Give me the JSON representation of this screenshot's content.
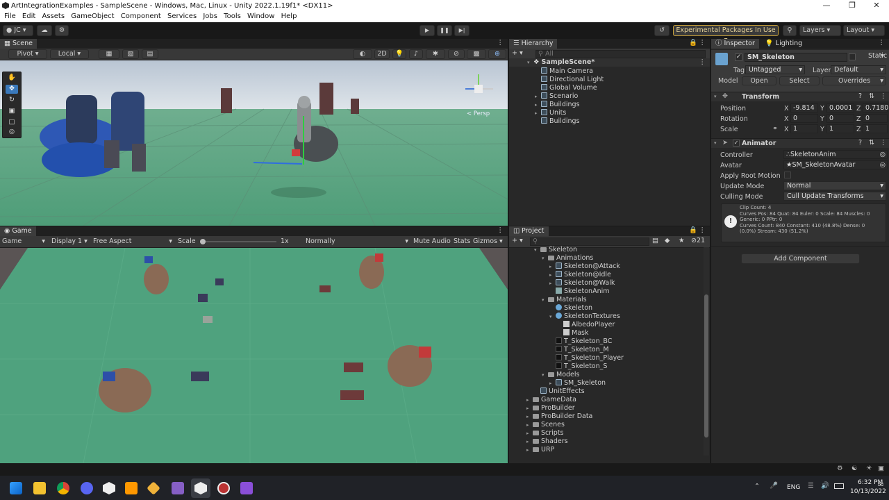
{
  "window": {
    "title": "ArtIntegrationExamples - SampleScene - Windows, Mac, Linux - Unity 2022.1.19f1* <DX11>"
  },
  "menu": [
    "File",
    "Edit",
    "Assets",
    "GameObject",
    "Component",
    "Services",
    "Jobs",
    "Tools",
    "Window",
    "Help"
  ],
  "toolbar": {
    "account": "JC",
    "experimental": "Experimental Packages In Use",
    "layers": "Layers",
    "layout": "Layout"
  },
  "scene": {
    "tab": "Scene",
    "pivot": "Pivot",
    "local": "Local",
    "mode2d": "2D",
    "persp": "< Persp"
  },
  "game": {
    "tab": "Game",
    "display_mode": "Game",
    "display": "Display 1",
    "aspect": "Free Aspect",
    "scale_label": "Scale",
    "scale_value": "1x",
    "play_mode": "Normally",
    "mute": "Mute Audio",
    "stats": "Stats",
    "gizmos": "Gizmos"
  },
  "hierarchy": {
    "tab": "Hierarchy",
    "search_placeholder": "All",
    "scene": "SampleScene*",
    "items": [
      "Main Camera",
      "Directional Light",
      "Global Volume",
      "Scenario",
      "Buildings",
      "Units",
      "Buildings"
    ]
  },
  "project": {
    "tab": "Project",
    "count": "21",
    "items": [
      {
        "label": "Skeleton",
        "indent": 2,
        "kind": "folder",
        "fold": "open"
      },
      {
        "label": "Animations",
        "indent": 3,
        "kind": "folder",
        "fold": "open"
      },
      {
        "label": "Skeleton@Attack",
        "indent": 4,
        "kind": "model",
        "fold": "closed"
      },
      {
        "label": "Skeleton@Idle",
        "indent": 4,
        "kind": "model",
        "fold": "closed"
      },
      {
        "label": "Skeleton@Walk",
        "indent": 4,
        "kind": "model",
        "fold": "closed"
      },
      {
        "label": "SkeletonAnim",
        "indent": 4,
        "kind": "anim",
        "fold": ""
      },
      {
        "label": "Materials",
        "indent": 3,
        "kind": "folder",
        "fold": "open"
      },
      {
        "label": "Skeleton",
        "indent": 4,
        "kind": "material",
        "fold": ""
      },
      {
        "label": "SkeletonTextures",
        "indent": 4,
        "kind": "material",
        "fold": "open"
      },
      {
        "label": "AlbedoPlayer",
        "indent": 5,
        "kind": "texture",
        "fold": ""
      },
      {
        "label": "Mask",
        "indent": 5,
        "kind": "texture",
        "fold": ""
      },
      {
        "label": "T_Skeleton_BC",
        "indent": 4,
        "kind": "darktex",
        "fold": ""
      },
      {
        "label": "T_Skeleton_M",
        "indent": 4,
        "kind": "darktex",
        "fold": ""
      },
      {
        "label": "T_Skeleton_Player",
        "indent": 4,
        "kind": "darktex",
        "fold": ""
      },
      {
        "label": "T_Skeleton_S",
        "indent": 4,
        "kind": "darktex",
        "fold": ""
      },
      {
        "label": "Models",
        "indent": 3,
        "kind": "folder",
        "fold": "open"
      },
      {
        "label": "SM_Skeleton",
        "indent": 4,
        "kind": "model",
        "fold": "closed"
      },
      {
        "label": "UnitEffects",
        "indent": 2,
        "kind": "prefab",
        "fold": ""
      },
      {
        "label": "GameData",
        "indent": 1,
        "kind": "folder",
        "fold": "closed"
      },
      {
        "label": "ProBuilder",
        "indent": 1,
        "kind": "folder",
        "fold": "closed"
      },
      {
        "label": "ProBuilder Data",
        "indent": 1,
        "kind": "folder",
        "fold": "closed"
      },
      {
        "label": "Scenes",
        "indent": 1,
        "kind": "folder",
        "fold": "closed"
      },
      {
        "label": "Scripts",
        "indent": 1,
        "kind": "folder",
        "fold": "closed"
      },
      {
        "label": "Shaders",
        "indent": 1,
        "kind": "folder",
        "fold": "closed"
      },
      {
        "label": "URP",
        "indent": 1,
        "kind": "folder",
        "fold": "closed"
      }
    ]
  },
  "inspector": {
    "tab": "Inspector",
    "lighting_tab": "Lighting",
    "object_name": "SM_Skeleton",
    "static": "Static",
    "tag_label": "Tag",
    "tag": "Untagged",
    "layer_label": "Layer",
    "layer": "Default",
    "model_label": "Model",
    "open": "Open",
    "select": "Select",
    "overrides": "Overrides",
    "transform": {
      "title": "Transform",
      "position_label": "Position",
      "rotation_label": "Rotation",
      "scale_label": "Scale",
      "position": {
        "x": "-9.814",
        "y": "0.0001",
        "z": "0.7180"
      },
      "rotation": {
        "x": "0",
        "y": "0",
        "z": "0"
      },
      "scale": {
        "x": "1",
        "y": "1",
        "z": "1"
      }
    },
    "animator": {
      "title": "Animator",
      "controller_label": "Controller",
      "controller": "SkeletonAnim",
      "avatar_label": "Avatar",
      "avatar": "SM_SkeletonAvatar",
      "root_motion_label": "Apply Root Motion",
      "update_mode_label": "Update Mode",
      "update_mode": "Normal",
      "culling_label": "Culling Mode",
      "culling": "Cull Update Transforms",
      "info": [
        "Clip Count: 4",
        "Curves Pos: 84 Quat: 84 Euler: 0 Scale: 84 Muscles: 0",
        "Generic: 0 PPtr: 0",
        "Curves Count: 840 Constant: 410 (48.8%) Dense: 0",
        "(0.0%) Stream: 430 (51.2%)"
      ]
    },
    "add_component": "Add Component"
  },
  "taskbar": {
    "lang": "ENG",
    "time": "6:32 PM",
    "date": "10/13/2022"
  },
  "colors": {
    "accent": "#3a79bb",
    "ground": "#4fa27e",
    "sky": "#c9d4de",
    "experimental_border": "#c7a03a"
  }
}
